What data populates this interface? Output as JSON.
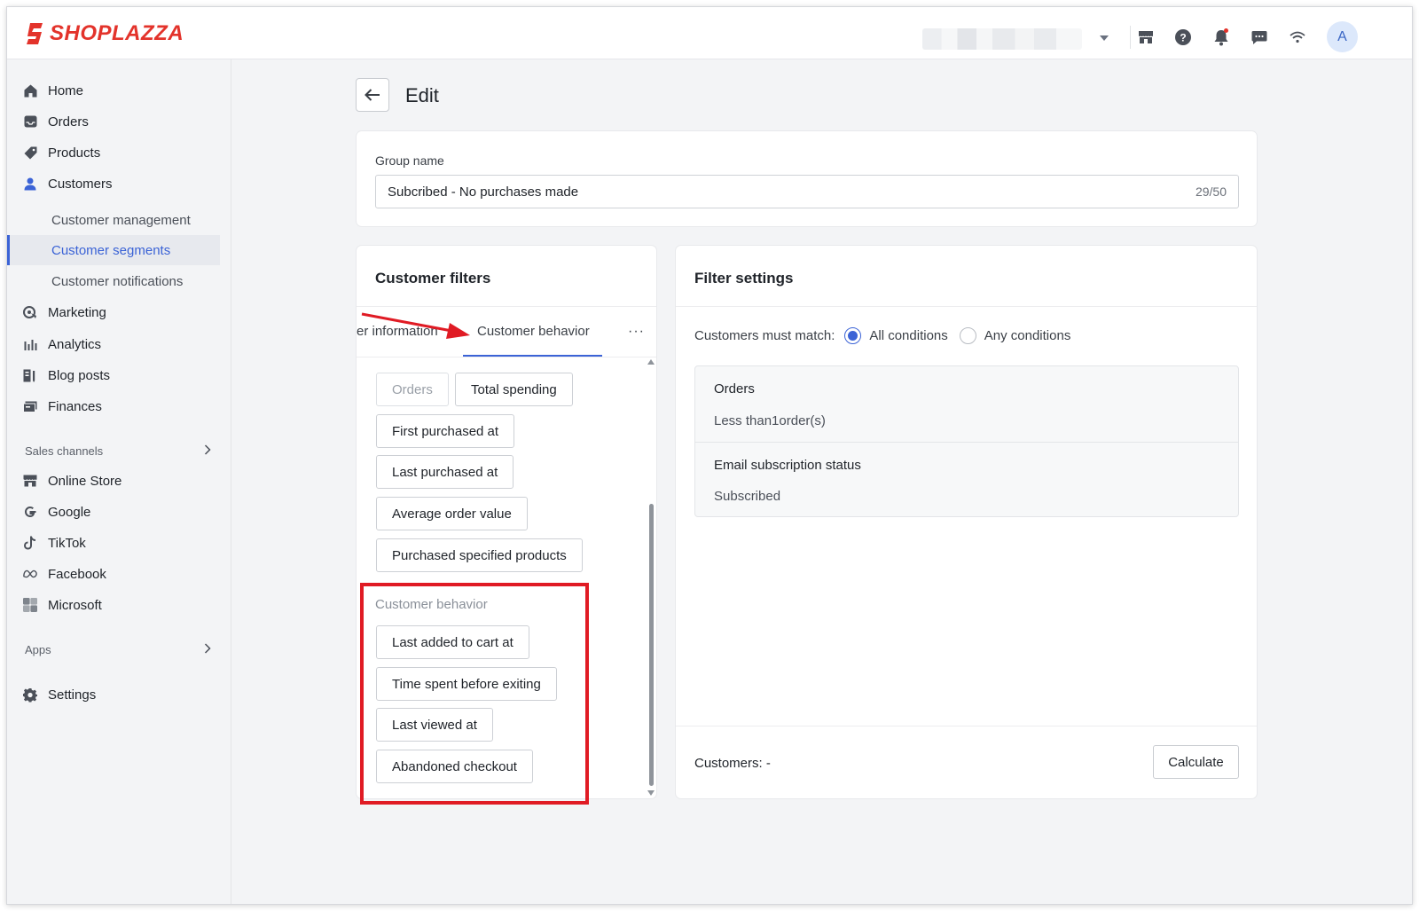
{
  "brand": {
    "name": "SHOPLAZZA",
    "color": "#e3332b"
  },
  "topbar": {
    "avatar_initial": "A",
    "icons": [
      "store-icon",
      "help-icon",
      "bell-icon",
      "chat-icon",
      "wifi-icon"
    ]
  },
  "sidebar": {
    "items": [
      {
        "label": "Home",
        "icon": "home-icon"
      },
      {
        "label": "Orders",
        "icon": "inbox-icon"
      },
      {
        "label": "Products",
        "icon": "tag-icon"
      },
      {
        "label": "Customers",
        "icon": "person-icon"
      }
    ],
    "customer_sub": [
      {
        "label": "Customer management"
      },
      {
        "label": "Customer segments",
        "active": true
      },
      {
        "label": "Customer notifications"
      }
    ],
    "items2": [
      {
        "label": "Marketing",
        "icon": "marketing-icon"
      },
      {
        "label": "Analytics",
        "icon": "bar-chart-icon"
      },
      {
        "label": "Blog posts",
        "icon": "blog-icon"
      },
      {
        "label": "Finances",
        "icon": "finance-icon"
      }
    ],
    "sales_channels_label": "Sales channels",
    "channels": [
      {
        "label": "Online Store",
        "icon": "store-icon"
      },
      {
        "label": "Google",
        "icon": "google-icon"
      },
      {
        "label": "TikTok",
        "icon": "tiktok-icon"
      },
      {
        "label": "Facebook",
        "icon": "meta-icon"
      },
      {
        "label": "Microsoft",
        "icon": "microsoft-icon"
      }
    ],
    "apps_label": "Apps",
    "settings_label": "Settings"
  },
  "page": {
    "title": "Edit"
  },
  "group": {
    "label": "Group name",
    "value": "Subcribed - No purchases made",
    "counter": "29/50"
  },
  "filters": {
    "title": "Customer filters",
    "tabs": [
      "er information",
      "Customer behavior"
    ],
    "more": "···",
    "orders_chips": [
      "Orders",
      "Total spending",
      "First purchased at",
      "Last purchased at",
      "Average order value",
      "Purchased specified products"
    ],
    "behavior_label": "Customer behavior",
    "behavior_chips": [
      "Last added to cart at",
      "Time spent before exiting",
      "Last viewed at",
      "Abandoned checkout"
    ]
  },
  "settings": {
    "title": "Filter settings",
    "match_label": "Customers must match:",
    "options": [
      {
        "label": "All conditions",
        "checked": true
      },
      {
        "label": "Any conditions",
        "checked": false
      }
    ],
    "conditions": [
      {
        "title": "Orders",
        "value": "Less than1order(s)"
      },
      {
        "title": "Email subscription status",
        "value": "Subscribed"
      }
    ],
    "customers_label": "Customers: -",
    "calculate_label": "Calculate"
  },
  "accent_color": "#3b63d6",
  "annotation_color": "#e01b24"
}
